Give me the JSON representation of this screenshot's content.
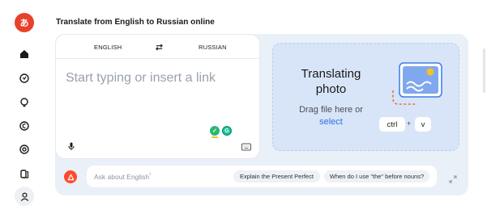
{
  "app": {
    "logo_text": "A",
    "logo_glyph": "あ"
  },
  "sidebar": {
    "items": [
      {
        "name": "home-icon"
      },
      {
        "name": "chat-icon"
      },
      {
        "name": "lightbulb-icon"
      },
      {
        "name": "currency-icon"
      },
      {
        "name": "target-icon"
      },
      {
        "name": "cards-icon"
      },
      {
        "name": "user-icon"
      }
    ]
  },
  "header": {
    "title": "Translate from English to Russian online"
  },
  "translator": {
    "source_lang": "ENGLISH",
    "target_lang": "RUSSIAN",
    "input_placeholder": "Start typing or insert a link",
    "swap_icon": "swap-arrows-icon",
    "mic_icon": "microphone-icon",
    "keyboard_icon": "keyboard-icon"
  },
  "photo": {
    "title": "Translating photo",
    "drag_text": "Drag file here or",
    "select_label": "select",
    "key_ctrl": "ctrl",
    "key_plus": "+",
    "key_v": "v"
  },
  "ask": {
    "placeholder": "Ask about English",
    "placeholder_mark": "⁵",
    "chips": [
      "Explain the Present Perfect",
      "When do I use \"the\" before nouns?"
    ]
  },
  "colors": {
    "accent_red": "#e8412b",
    "link_blue": "#2a6fe0",
    "panel_bg": "#eaf0f8",
    "photo_bg": "#d8e5f8"
  }
}
